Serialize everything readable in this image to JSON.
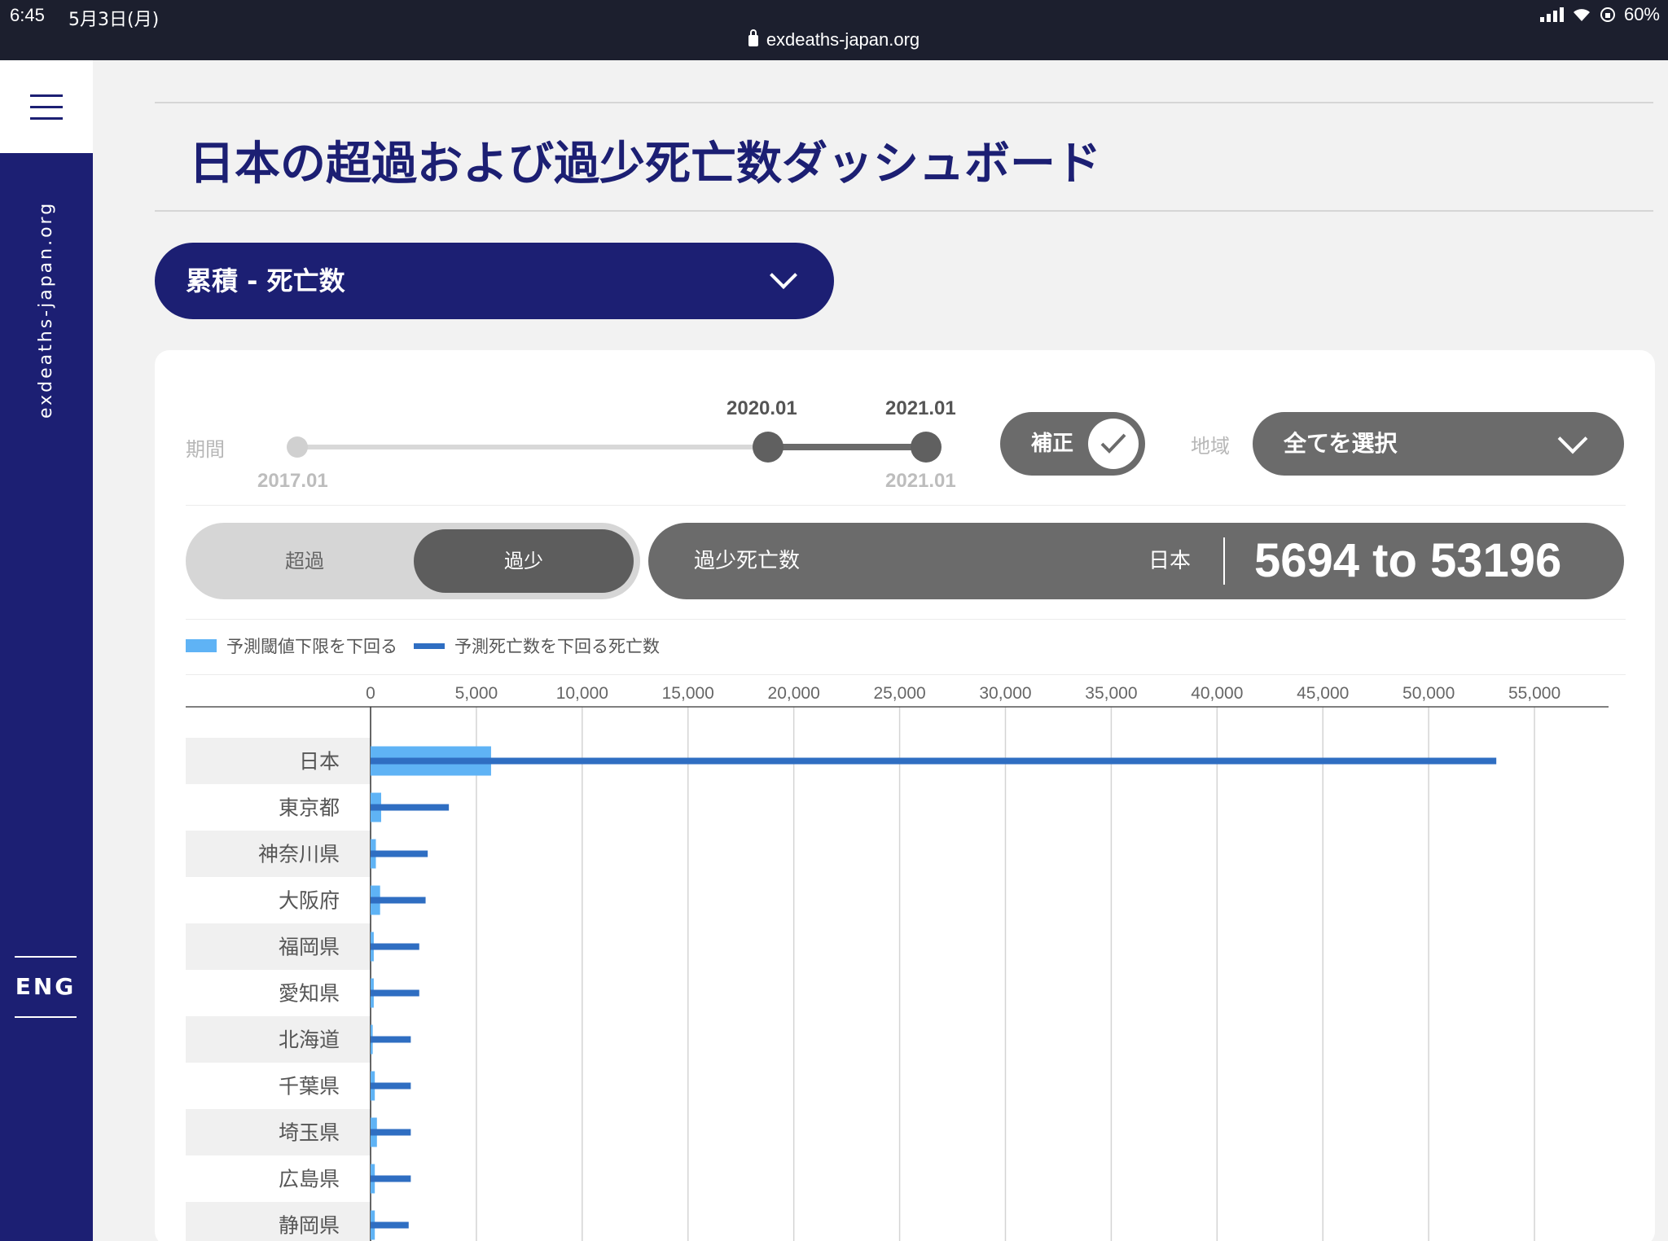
{
  "status_bar": {
    "time": "6:45",
    "date": "5月3日(月)",
    "battery": "60%",
    "url": "exdeaths-japan.org"
  },
  "sidebar": {
    "site_name": "exdeaths-japan.org",
    "language_label": "ENG"
  },
  "header": {
    "title": "日本の超過および過少死亡数ダッシュボード"
  },
  "metric_selector": {
    "selected": "累積 - 死亡数"
  },
  "controls": {
    "period_label": "期間",
    "period_start": "2017.01",
    "period_end": "2021.01",
    "selected_from": "2020.01",
    "selected_to": "2021.01",
    "adjust_label": "補正",
    "adjust_checked": true,
    "region_label": "地域",
    "region_selected": "全てを選択"
  },
  "mode_toggle": {
    "options": [
      "超過",
      "過少"
    ],
    "selected": "過少"
  },
  "summary": {
    "label": "過少死亡数",
    "region": "日本",
    "range": "5694 to 53196"
  },
  "colors": {
    "navy": "#1c1f73",
    "light_bar": "#5fb3f5",
    "dark_bar": "#2f6ec2"
  },
  "chart_data": {
    "type": "bar",
    "orientation": "horizontal",
    "legend": [
      {
        "name": "予測閾値下限を下回る",
        "color": "#5fb3f5"
      },
      {
        "name": "予測死亡数を下回る死亡数",
        "color": "#2f6ec2"
      }
    ],
    "x_ticks": [
      "0",
      "5,000",
      "10,000",
      "15,000",
      "20,000",
      "25,000",
      "30,000",
      "35,000",
      "40,000",
      "45,000",
      "50,000",
      "55,000"
    ],
    "xlim": [
      0,
      58500
    ],
    "categories": [
      "日本",
      "東京都",
      "神奈川県",
      "大阪府",
      "福岡県",
      "愛知県",
      "北海道",
      "千葉県",
      "埼玉県",
      "広島県",
      "静岡県"
    ],
    "series": [
      {
        "name": "予測閾値下限を下回る",
        "values": [
          5694,
          500,
          250,
          450,
          150,
          150,
          100,
          200,
          300,
          200,
          200
        ]
      },
      {
        "name": "予測死亡数を下回る死亡数",
        "values": [
          53196,
          3700,
          2700,
          2600,
          2300,
          2300,
          1900,
          1900,
          1900,
          1900,
          1800
        ]
      }
    ]
  }
}
